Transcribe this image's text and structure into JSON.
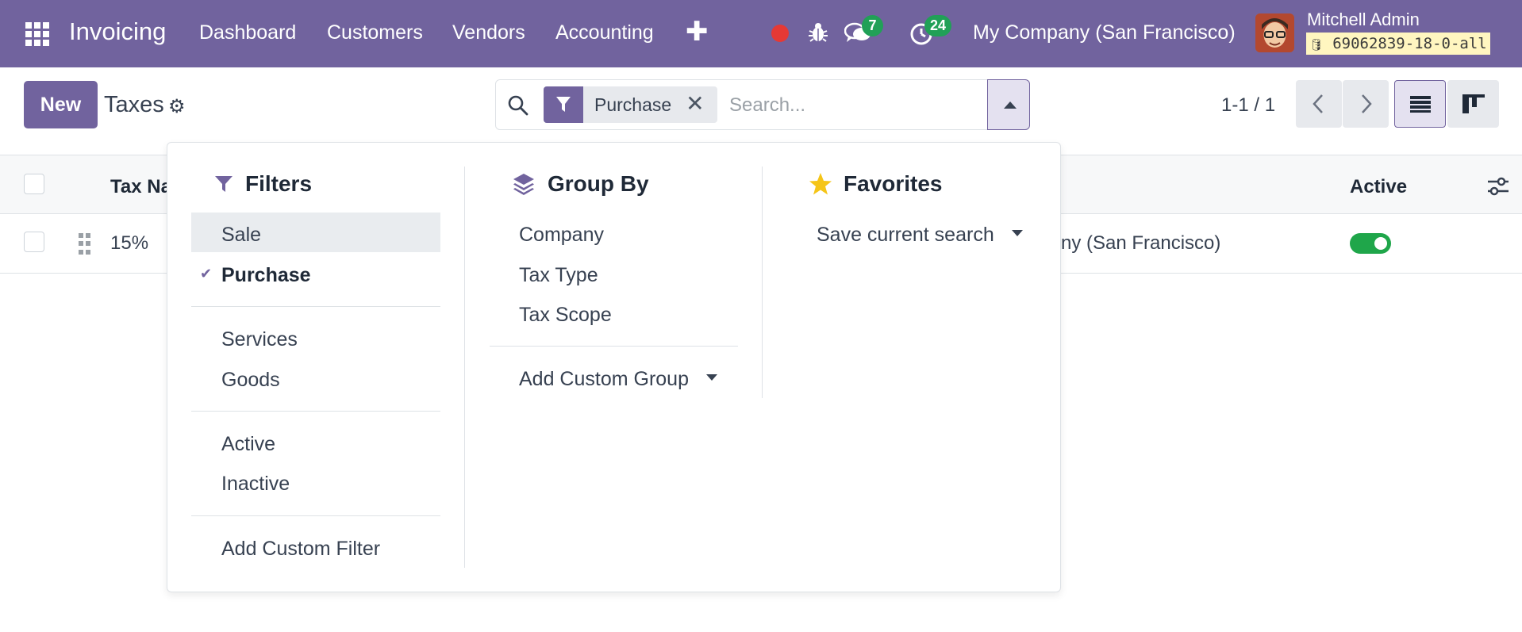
{
  "navbar": {
    "brand": "Invoicing",
    "menu": [
      "Dashboard",
      "Customers",
      "Vendors",
      "Accounting"
    ],
    "messages_badge": "7",
    "activities_badge": "24",
    "company": "My Company (San Francisco)",
    "user_name": "Mitchell Admin",
    "db_name": "69062839-18-0-all",
    "colors": {
      "primary": "#71639e",
      "badge": "#21a057",
      "record": "#e53935"
    }
  },
  "control_panel": {
    "new_label": "New",
    "title": "Taxes",
    "facet_label": "Purchase",
    "search_placeholder": "Search...",
    "pager": "1-1 / 1"
  },
  "list": {
    "columns": {
      "name": "Tax Na",
      "active": "Active"
    },
    "rows": [
      {
        "name": "15%",
        "company": "ny (San Francisco)",
        "active": true
      }
    ]
  },
  "dropdown": {
    "filters": {
      "title": "Filters",
      "items": [
        "Sale",
        "Purchase",
        "Services",
        "Goods",
        "Active",
        "Inactive"
      ],
      "add_custom": "Add Custom Filter"
    },
    "group_by": {
      "title": "Group By",
      "items": [
        "Company",
        "Tax Type",
        "Tax Scope"
      ],
      "add_custom": "Add Custom Group"
    },
    "favorites": {
      "title": "Favorites",
      "save_current": "Save current search"
    }
  }
}
